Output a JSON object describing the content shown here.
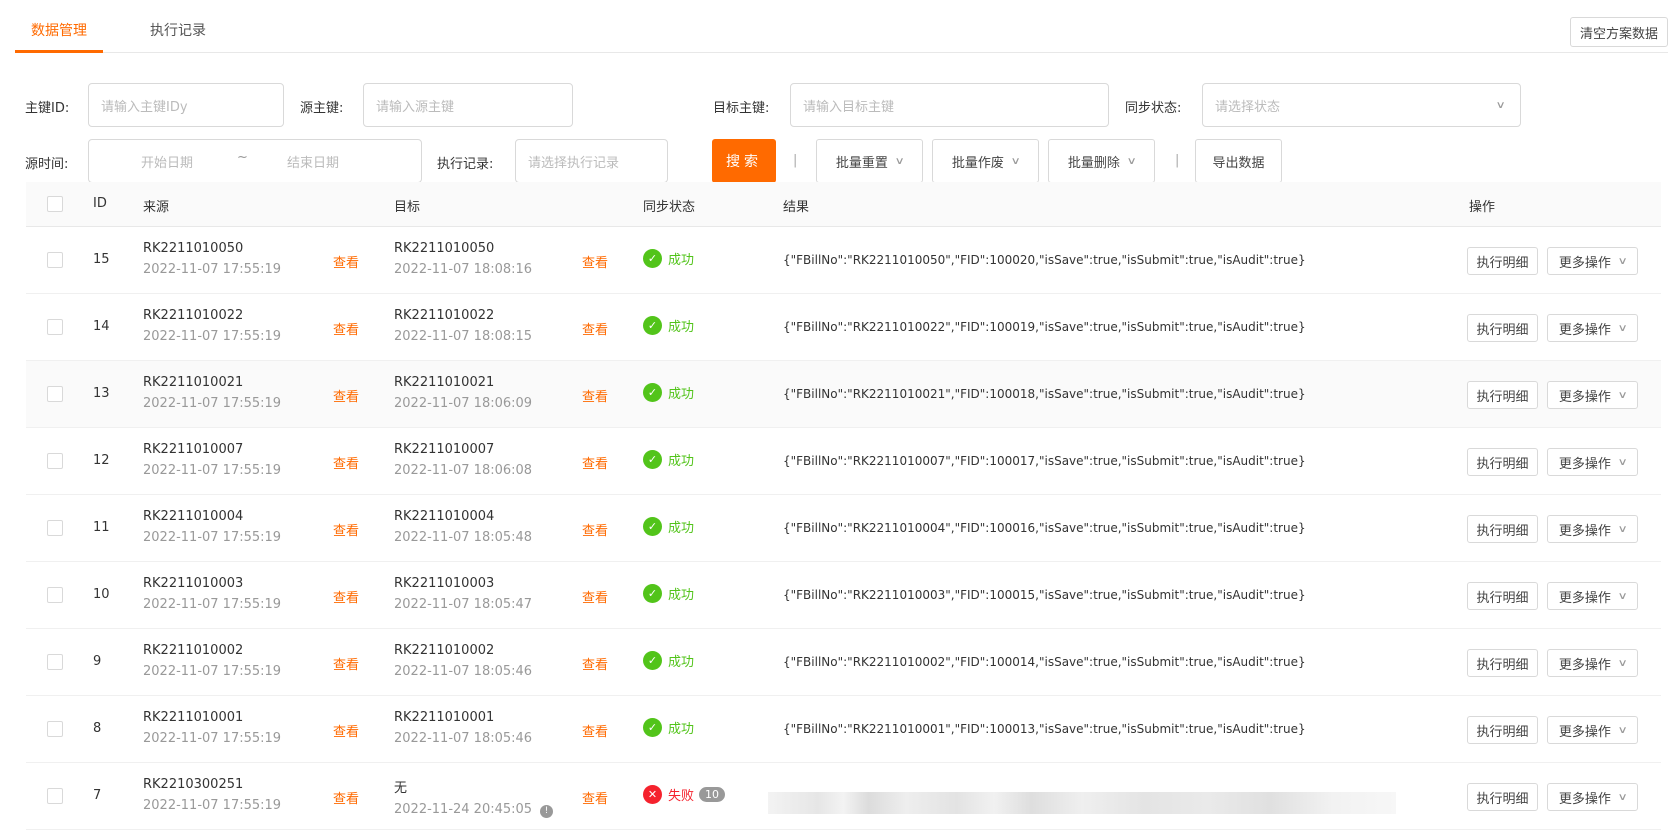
{
  "tabs": [
    "数据管理",
    "执行记录"
  ],
  "clear_button": "清空方案数据",
  "filters": {
    "pk_label": "主键ID:",
    "pk_placeholder": "请输入主键IDy",
    "src_label": "源主键:",
    "src_placeholder": "请输入源主键",
    "tgt_label": "目标主键:",
    "tgt_placeholder": "请输入目标主键",
    "status_label": "同步状态:",
    "status_placeholder": "请选择状态",
    "time_label": "源时间:",
    "start_placeholder": "开始日期",
    "range_sep": "~",
    "end_placeholder": "结束日期",
    "exec_label": "执行记录:",
    "exec_placeholder": "请选择执行记录"
  },
  "toolbar": {
    "search": "搜索",
    "divider": "|",
    "batch_reset": "批量重置",
    "batch_void": "批量作废",
    "batch_delete": "批量删除",
    "export": "导出数据"
  },
  "table": {
    "headers": {
      "id": "ID",
      "source": "来源",
      "target": "目标",
      "status": "同步状态",
      "result": "结果",
      "actions": "操作"
    },
    "view_label": "查看",
    "detail_label": "执行明细",
    "more_label": "更多操作",
    "rows": [
      {
        "id": "15",
        "src": "RK2211010050",
        "src_time": "2022-11-07 17:55:19",
        "tgt": "RK2211010050",
        "tgt_time": "2022-11-07 18:08:16",
        "status": "成功",
        "result": "{\"FBillNo\":\"RK2211010050\",\"FID\":100020,\"isSave\":true,\"isSubmit\":true,\"isAudit\":true}"
      },
      {
        "id": "14",
        "src": "RK2211010022",
        "src_time": "2022-11-07 17:55:19",
        "tgt": "RK2211010022",
        "tgt_time": "2022-11-07 18:08:15",
        "status": "成功",
        "result": "{\"FBillNo\":\"RK2211010022\",\"FID\":100019,\"isSave\":true,\"isSubmit\":true,\"isAudit\":true}"
      },
      {
        "id": "13",
        "src": "RK2211010021",
        "src_time": "2022-11-07 17:55:19",
        "tgt": "RK2211010021",
        "tgt_time": "2022-11-07 18:06:09",
        "status": "成功",
        "result": "{\"FBillNo\":\"RK2211010021\",\"FID\":100018,\"isSave\":true,\"isSubmit\":true,\"isAudit\":true}"
      },
      {
        "id": "12",
        "src": "RK2211010007",
        "src_time": "2022-11-07 17:55:19",
        "tgt": "RK2211010007",
        "tgt_time": "2022-11-07 18:06:08",
        "status": "成功",
        "result": "{\"FBillNo\":\"RK2211010007\",\"FID\":100017,\"isSave\":true,\"isSubmit\":true,\"isAudit\":true}"
      },
      {
        "id": "11",
        "src": "RK2211010004",
        "src_time": "2022-11-07 17:55:19",
        "tgt": "RK2211010004",
        "tgt_time": "2022-11-07 18:05:48",
        "status": "成功",
        "result": "{\"FBillNo\":\"RK2211010004\",\"FID\":100016,\"isSave\":true,\"isSubmit\":true,\"isAudit\":true}"
      },
      {
        "id": "10",
        "src": "RK2211010003",
        "src_time": "2022-11-07 17:55:19",
        "tgt": "RK2211010003",
        "tgt_time": "2022-11-07 18:05:47",
        "status": "成功",
        "result": "{\"FBillNo\":\"RK2211010003\",\"FID\":100015,\"isSave\":true,\"isSubmit\":true,\"isAudit\":true}"
      },
      {
        "id": "9",
        "src": "RK2211010002",
        "src_time": "2022-11-07 17:55:19",
        "tgt": "RK2211010002",
        "tgt_time": "2022-11-07 18:05:46",
        "status": "成功",
        "result": "{\"FBillNo\":\"RK2211010002\",\"FID\":100014,\"isSave\":true,\"isSubmit\":true,\"isAudit\":true}"
      },
      {
        "id": "8",
        "src": "RK2211010001",
        "src_time": "2022-11-07 17:55:19",
        "tgt": "RK2211010001",
        "tgt_time": "2022-11-07 18:05:46",
        "status": "成功",
        "result": "{\"FBillNo\":\"RK2211010001\",\"FID\":100013,\"isSave\":true,\"isSubmit\":true,\"isAudit\":true}"
      },
      {
        "id": "7",
        "src": "RK2210300251",
        "src_time": "2022-11-07 17:55:19",
        "tgt": "无",
        "tgt_time": "2022-11-24 20:45:05",
        "status": "失败",
        "fail_count": "10"
      }
    ]
  },
  "colors": {
    "accent": "#ff6a00",
    "success": "#52c41a",
    "fail": "#f5222d"
  }
}
